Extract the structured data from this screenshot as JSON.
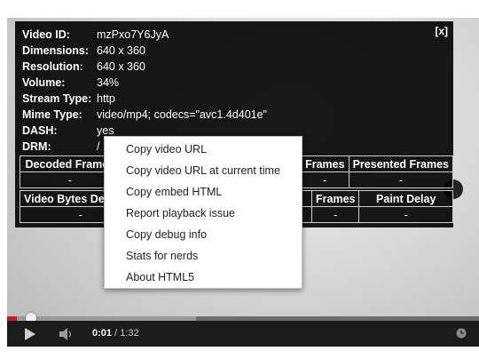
{
  "stats": {
    "close_label": "[x]",
    "rows": [
      {
        "key": "Video ID:",
        "value": "mzPxo7Y6JyA"
      },
      {
        "key": "Dimensions:",
        "value": "640 x 360"
      },
      {
        "key": "Resolution:",
        "value": "640 x 360"
      },
      {
        "key": "Volume:",
        "value": "34%"
      },
      {
        "key": "Stream Type:",
        "value": "http"
      },
      {
        "key": "Mime Type:",
        "value": "video/mp4; codecs=\"avc1.4d401e\""
      },
      {
        "key": "DASH:",
        "value": "yes"
      },
      {
        "key": "DRM:",
        "value": "/"
      }
    ],
    "frames_table": {
      "row1_headers": [
        "Decoded Frames",
        "",
        "Frames",
        "Presented Frames"
      ],
      "row1_values": [
        "-",
        "",
        "-",
        "-"
      ],
      "row2_headers": [
        "Video Bytes Decoded",
        "",
        "Frames",
        "Paint Delay"
      ],
      "row2_values": [
        "-",
        "",
        "-",
        "-"
      ]
    }
  },
  "context_menu": {
    "items": [
      "Copy video URL",
      "Copy video URL at current time",
      "Copy embed HTML",
      "Report playback issue",
      "Copy debug info",
      "Stats for nerds",
      "About HTML5"
    ]
  },
  "player": {
    "current_time": "0:01",
    "separator": " / ",
    "duration": "1:32",
    "progress_played_fraction": 0.02,
    "progress_loaded_fraction": 0.4,
    "colors": {
      "played": "#cc181e",
      "loaded": "#9a9a9a",
      "track": "#6d6d6d"
    },
    "icons": [
      "play-icon",
      "volume-icon",
      "clock-icon"
    ]
  }
}
